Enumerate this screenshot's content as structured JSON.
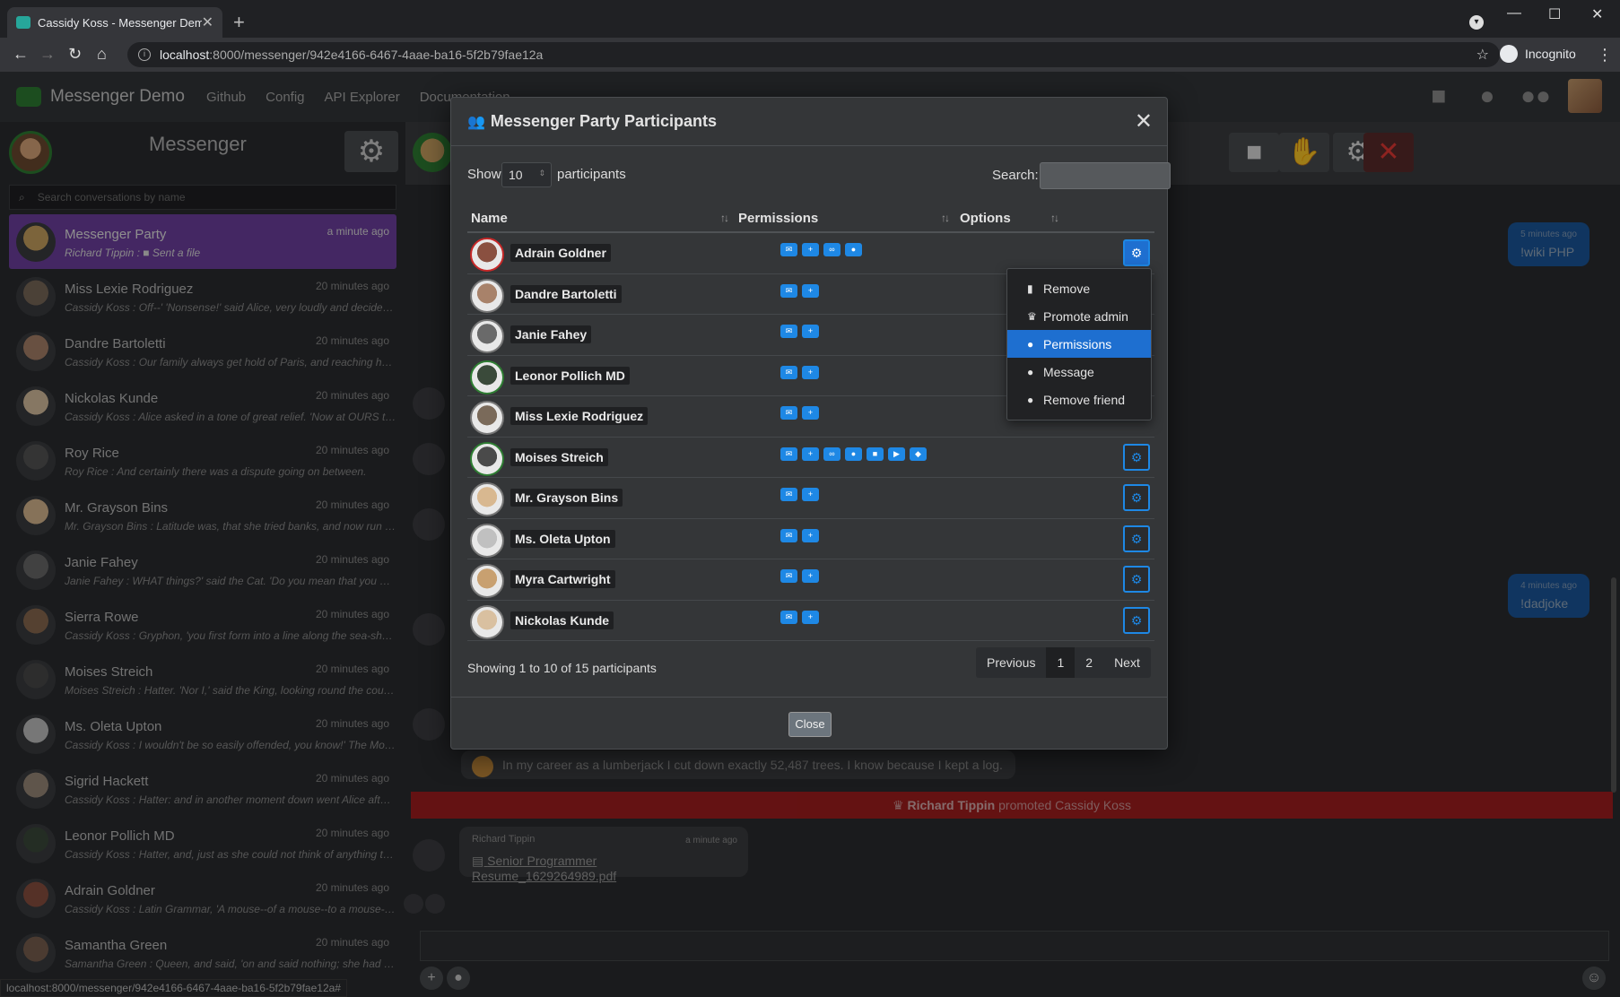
{
  "browser": {
    "tab_title": "Cassidy Koss - Messenger Demo",
    "url_host": "localhost",
    "url_path": ":8000/messenger/942e4166-6467-4aae-ba16-5f2b79fae12a",
    "profile_label": "Incognito",
    "status_url": "localhost:8000/messenger/942e4166-6467-4aae-ba16-5f2b79fae12a#"
  },
  "appnav": {
    "brand": "Messenger Demo",
    "links": [
      "Github",
      "Config",
      "API Explorer",
      "Documentation"
    ]
  },
  "sidebar": {
    "title": "Messenger",
    "search_placeholder": "Search conversations by name",
    "conversations": [
      {
        "name": "Messenger Party",
        "time": "a minute ago",
        "preview": "Richard Tippin : ■ Sent a file",
        "color": "#c9a25f"
      },
      {
        "name": "Miss Lexie Rodriguez",
        "time": "20 minutes ago",
        "preview": "Cassidy Koss : Off--' 'Nonsense!' said Alice, very loudly and decidedly...",
        "color": "#7a6a5a"
      },
      {
        "name": "Dandre Bartoletti",
        "time": "20 minutes ago",
        "preview": "Cassidy Koss : Our family always get hold of Paris, and reaching half ...",
        "color": "#a8826a"
      },
      {
        "name": "Nickolas Kunde",
        "time": "20 minutes ago",
        "preview": "Cassidy Koss : Alice asked in a tone of great relief. 'Now at OURS the...",
        "color": "#d9c0a0"
      },
      {
        "name": "Roy Rice",
        "time": "20 minutes ago",
        "preview": "Roy Rice : And certainly there was a dispute going on between.",
        "color": "#555"
      },
      {
        "name": "Mr. Grayson Bins",
        "time": "20 minutes ago",
        "preview": "Mr. Grayson Bins : Latitude was, that she tried banks, and now run ba...",
        "color": "#d8b890"
      },
      {
        "name": "Janie Fahey",
        "time": "20 minutes ago",
        "preview": "Janie Fahey : WHAT things?' said the Cat. 'Do you mean that you we...",
        "color": "#6a6a6a"
      },
      {
        "name": "Sierra Rowe",
        "time": "20 minutes ago",
        "preview": "Cassidy Koss : Gryphon, 'you first form into a line along the sea-shor...",
        "color": "#8a6a50"
      },
      {
        "name": "Moises Streich",
        "time": "20 minutes ago",
        "preview": "Moises Streich : Hatter. 'Nor I,' said the King, looking round the court ...",
        "color": "#4a4a4a"
      },
      {
        "name": "Ms. Oleta Upton",
        "time": "20 minutes ago",
        "preview": "Cassidy Koss : I wouldn't be so easily offended, you know!' The Mous...",
        "color": "#c0c0c0"
      },
      {
        "name": "Sigrid Hackett",
        "time": "20 minutes ago",
        "preview": "Cassidy Koss : Hatter: and in another moment down went Alice after...",
        "color": "#9a8a7a"
      },
      {
        "name": "Leonor Pollich MD",
        "time": "20 minutes ago",
        "preview": "Cassidy Koss : Hatter, and, just as she could not think of anything to ...",
        "color": "#3a4a3a"
      },
      {
        "name": "Adrain Goldner",
        "time": "20 minutes ago",
        "preview": "Cassidy Koss : Latin Grammar, 'A mouse--of a mouse--to a mouse--a ...",
        "color": "#8a5040"
      },
      {
        "name": "Samantha Green",
        "time": "20 minutes ago",
        "preview": "Samantha Green : Queen, and said, 'on and said nothing; she had put ...",
        "color": "#7a6050"
      }
    ]
  },
  "chat": {
    "bubbles": [
      {
        "when": "5 minutes ago",
        "text": "!wiki PHP"
      },
      {
        "when": "4 minutes ago",
        "text": "!dadjoke"
      }
    ],
    "joke_text": "In my career as a lumberjack I cut down exactly 52,487 trees. I know because I kept a log.",
    "promo_actor": "Richard Tippin",
    "promo_rest": " promoted Cassidy Koss",
    "file_sender": "Richard Tippin",
    "file_time": "a minute ago",
    "file_name": "Senior Programmer Resume_1629264989.pdf"
  },
  "modal": {
    "title": "Messenger Party Participants",
    "show_label": "Show",
    "page_length": "10",
    "participants_label": "participants",
    "search_label": "Search:",
    "search_value": "",
    "columns": {
      "name": "Name",
      "permissions": "Permissions",
      "options": "Options"
    },
    "rows": [
      {
        "name": "Adrain Goldner",
        "perms": 4,
        "color": "#8a5040",
        "ring": "red"
      },
      {
        "name": "Dandre Bartoletti",
        "perms": 2,
        "color": "#a8826a",
        "ring": "gray"
      },
      {
        "name": "Janie Fahey",
        "perms": 2,
        "color": "#6a6a6a",
        "ring": "gray"
      },
      {
        "name": "Leonor Pollich MD",
        "perms": 2,
        "color": "#3a4a3a",
        "ring": "green"
      },
      {
        "name": "Miss Lexie Rodriguez",
        "perms": 2,
        "color": "#7a6a5a",
        "ring": "gray"
      },
      {
        "name": "Moises Streich",
        "perms": 7,
        "color": "#4a4a4a",
        "ring": "green"
      },
      {
        "name": "Mr. Grayson Bins",
        "perms": 2,
        "color": "#d8b890",
        "ring": "gray"
      },
      {
        "name": "Ms. Oleta Upton",
        "perms": 2,
        "color": "#c0c0c0",
        "ring": "gray"
      },
      {
        "name": "Myra Cartwright",
        "perms": 2,
        "color": "#c8a070",
        "ring": "gray"
      },
      {
        "name": "Nickolas Kunde",
        "perms": 2,
        "color": "#d9c0a0",
        "ring": "gray"
      }
    ],
    "dropdown": [
      "Remove",
      "Promote admin",
      "Permissions",
      "Message",
      "Remove friend"
    ],
    "info": "Showing 1 to 10 of 15 participants",
    "pager": {
      "prev": "Previous",
      "p1": "1",
      "p2": "2",
      "next": "Next"
    },
    "close": "Close"
  }
}
